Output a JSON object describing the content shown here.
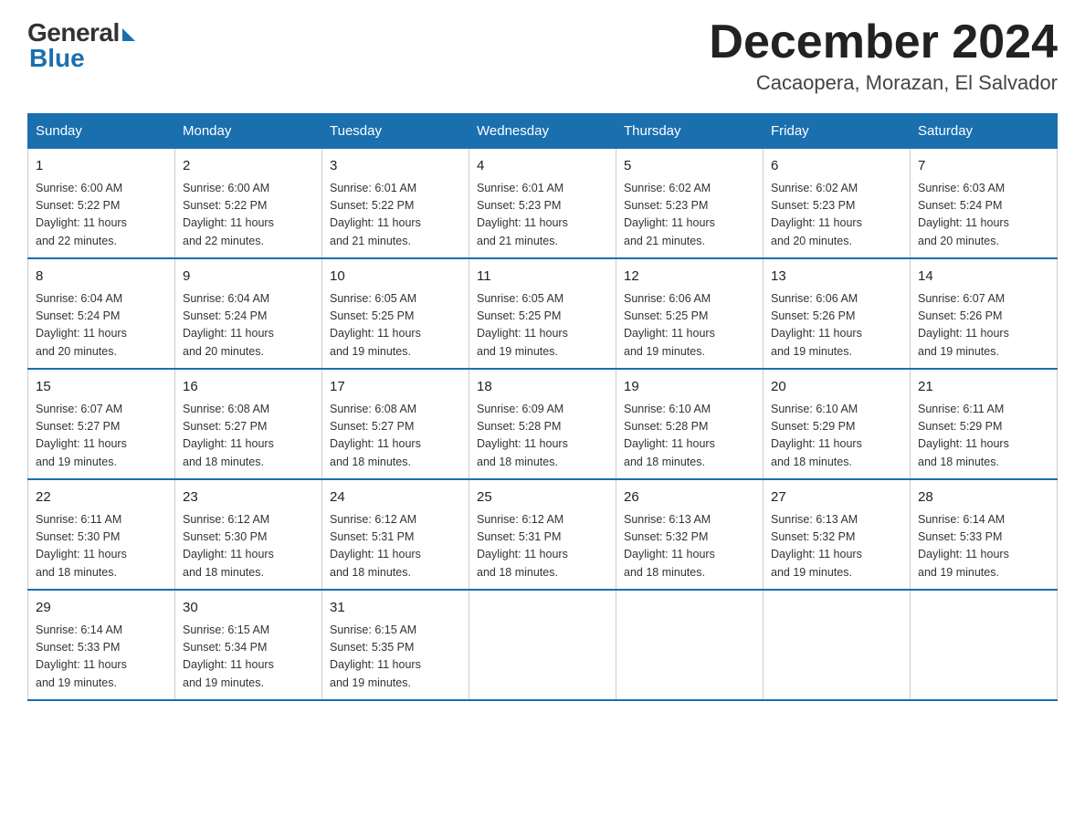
{
  "header": {
    "logo_general": "General",
    "logo_blue": "Blue",
    "title": "December 2024",
    "location": "Cacaopera, Morazan, El Salvador"
  },
  "weekdays": [
    "Sunday",
    "Monday",
    "Tuesday",
    "Wednesday",
    "Thursday",
    "Friday",
    "Saturday"
  ],
  "weeks": [
    [
      {
        "day": "1",
        "info": "Sunrise: 6:00 AM\nSunset: 5:22 PM\nDaylight: 11 hours\nand 22 minutes."
      },
      {
        "day": "2",
        "info": "Sunrise: 6:00 AM\nSunset: 5:22 PM\nDaylight: 11 hours\nand 22 minutes."
      },
      {
        "day": "3",
        "info": "Sunrise: 6:01 AM\nSunset: 5:22 PM\nDaylight: 11 hours\nand 21 minutes."
      },
      {
        "day": "4",
        "info": "Sunrise: 6:01 AM\nSunset: 5:23 PM\nDaylight: 11 hours\nand 21 minutes."
      },
      {
        "day": "5",
        "info": "Sunrise: 6:02 AM\nSunset: 5:23 PM\nDaylight: 11 hours\nand 21 minutes."
      },
      {
        "day": "6",
        "info": "Sunrise: 6:02 AM\nSunset: 5:23 PM\nDaylight: 11 hours\nand 20 minutes."
      },
      {
        "day": "7",
        "info": "Sunrise: 6:03 AM\nSunset: 5:24 PM\nDaylight: 11 hours\nand 20 minutes."
      }
    ],
    [
      {
        "day": "8",
        "info": "Sunrise: 6:04 AM\nSunset: 5:24 PM\nDaylight: 11 hours\nand 20 minutes."
      },
      {
        "day": "9",
        "info": "Sunrise: 6:04 AM\nSunset: 5:24 PM\nDaylight: 11 hours\nand 20 minutes."
      },
      {
        "day": "10",
        "info": "Sunrise: 6:05 AM\nSunset: 5:25 PM\nDaylight: 11 hours\nand 19 minutes."
      },
      {
        "day": "11",
        "info": "Sunrise: 6:05 AM\nSunset: 5:25 PM\nDaylight: 11 hours\nand 19 minutes."
      },
      {
        "day": "12",
        "info": "Sunrise: 6:06 AM\nSunset: 5:25 PM\nDaylight: 11 hours\nand 19 minutes."
      },
      {
        "day": "13",
        "info": "Sunrise: 6:06 AM\nSunset: 5:26 PM\nDaylight: 11 hours\nand 19 minutes."
      },
      {
        "day": "14",
        "info": "Sunrise: 6:07 AM\nSunset: 5:26 PM\nDaylight: 11 hours\nand 19 minutes."
      }
    ],
    [
      {
        "day": "15",
        "info": "Sunrise: 6:07 AM\nSunset: 5:27 PM\nDaylight: 11 hours\nand 19 minutes."
      },
      {
        "day": "16",
        "info": "Sunrise: 6:08 AM\nSunset: 5:27 PM\nDaylight: 11 hours\nand 18 minutes."
      },
      {
        "day": "17",
        "info": "Sunrise: 6:08 AM\nSunset: 5:27 PM\nDaylight: 11 hours\nand 18 minutes."
      },
      {
        "day": "18",
        "info": "Sunrise: 6:09 AM\nSunset: 5:28 PM\nDaylight: 11 hours\nand 18 minutes."
      },
      {
        "day": "19",
        "info": "Sunrise: 6:10 AM\nSunset: 5:28 PM\nDaylight: 11 hours\nand 18 minutes."
      },
      {
        "day": "20",
        "info": "Sunrise: 6:10 AM\nSunset: 5:29 PM\nDaylight: 11 hours\nand 18 minutes."
      },
      {
        "day": "21",
        "info": "Sunrise: 6:11 AM\nSunset: 5:29 PM\nDaylight: 11 hours\nand 18 minutes."
      }
    ],
    [
      {
        "day": "22",
        "info": "Sunrise: 6:11 AM\nSunset: 5:30 PM\nDaylight: 11 hours\nand 18 minutes."
      },
      {
        "day": "23",
        "info": "Sunrise: 6:12 AM\nSunset: 5:30 PM\nDaylight: 11 hours\nand 18 minutes."
      },
      {
        "day": "24",
        "info": "Sunrise: 6:12 AM\nSunset: 5:31 PM\nDaylight: 11 hours\nand 18 minutes."
      },
      {
        "day": "25",
        "info": "Sunrise: 6:12 AM\nSunset: 5:31 PM\nDaylight: 11 hours\nand 18 minutes."
      },
      {
        "day": "26",
        "info": "Sunrise: 6:13 AM\nSunset: 5:32 PM\nDaylight: 11 hours\nand 18 minutes."
      },
      {
        "day": "27",
        "info": "Sunrise: 6:13 AM\nSunset: 5:32 PM\nDaylight: 11 hours\nand 19 minutes."
      },
      {
        "day": "28",
        "info": "Sunrise: 6:14 AM\nSunset: 5:33 PM\nDaylight: 11 hours\nand 19 minutes."
      }
    ],
    [
      {
        "day": "29",
        "info": "Sunrise: 6:14 AM\nSunset: 5:33 PM\nDaylight: 11 hours\nand 19 minutes."
      },
      {
        "day": "30",
        "info": "Sunrise: 6:15 AM\nSunset: 5:34 PM\nDaylight: 11 hours\nand 19 minutes."
      },
      {
        "day": "31",
        "info": "Sunrise: 6:15 AM\nSunset: 5:35 PM\nDaylight: 11 hours\nand 19 minutes."
      },
      {
        "day": "",
        "info": ""
      },
      {
        "day": "",
        "info": ""
      },
      {
        "day": "",
        "info": ""
      },
      {
        "day": "",
        "info": ""
      }
    ]
  ]
}
